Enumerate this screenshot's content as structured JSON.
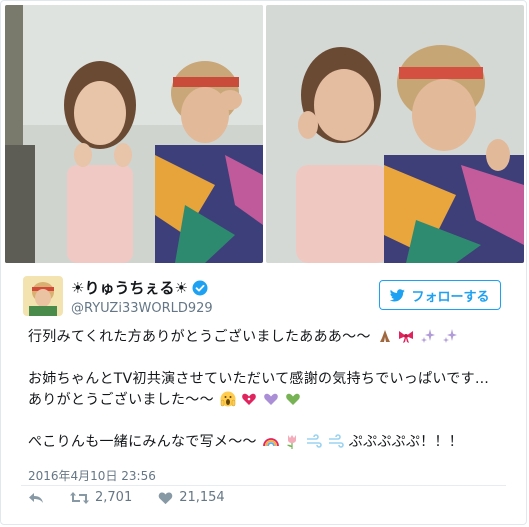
{
  "tweet": {
    "display_name": "☀りゅうちぇる☀",
    "handle": "@RYUZi33WORLD929",
    "follow_label": "フォローする",
    "lines": [
      "行列みてくれた方ありがとうございましたあああ～～",
      "お姉ちゃんとTV初共演させていただいて感謝の気持ちでいっぱいです…",
      "ありがとうございました～～",
      "ぺこりんも一緒にみんなで写メ～～",
      "ぷぷぷぷぷ！！！"
    ],
    "timestamp": "2016年4月10日 23:56",
    "retweet_count": "2,701",
    "like_count": "21,154"
  },
  "icons": {
    "verified": "verified-badge-icon",
    "bird": "twitter-bird-icon",
    "reply": "reply-icon",
    "retweet": "retweet-icon",
    "like": "heart-icon"
  },
  "colors": {
    "accent": "#1da1f2",
    "text": "#14171a",
    "muted": "#657786"
  }
}
